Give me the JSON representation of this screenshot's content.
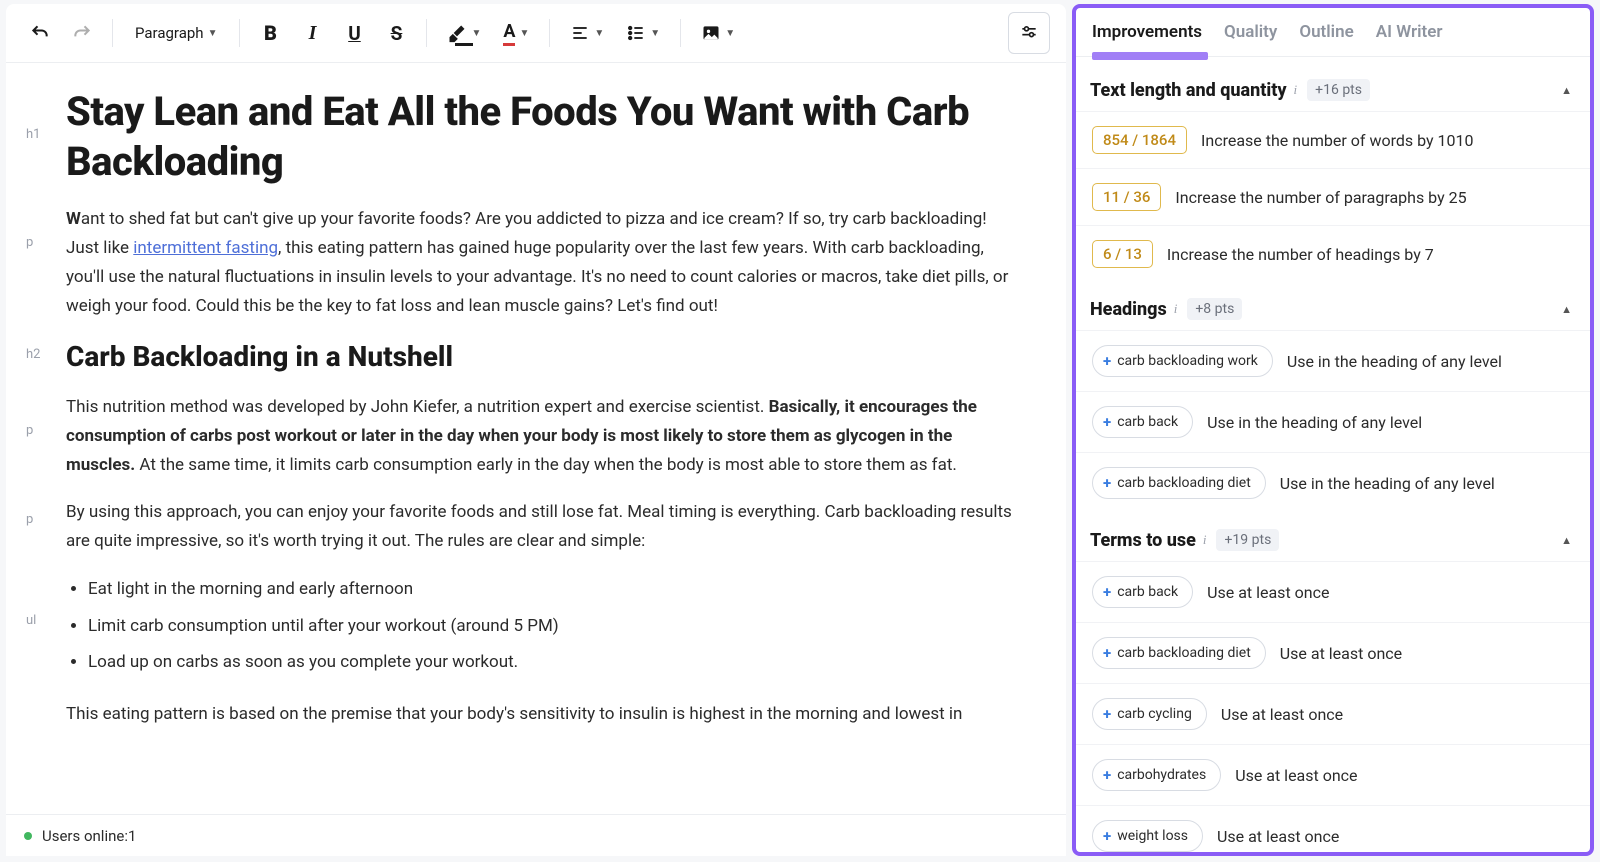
{
  "toolbar": {
    "block_format": "Paragraph"
  },
  "document": {
    "h1_tag": "h1",
    "h1": "Stay Lean and Eat All the Foods You Want with Carb Backloading",
    "p1_tag": "p",
    "p1_lead": "W",
    "p1_a": "ant to shed fat but can't give up your favorite foods? Are you addicted to pizza and ice cream? If so, try carb backloading! Just like ",
    "p1_link": "intermittent fasting",
    "p1_b": ", this eating pattern has gained huge popularity over the last few years. With carb backloading, you'll use the natural fluctuations in insulin levels to your advantage. It's no need to count calories or macros, take diet pills, or weigh your food. Could this be the key to fat loss and lean muscle gains? Let's find out!",
    "h2_tag": "h2",
    "h2": "Carb Backloading in a Nutshell",
    "p2_tag": "p",
    "p2_a": "This nutrition method was developed by John Kiefer, a nutrition expert and exercise scientist. ",
    "p2_bold": "Basically, it encourages the consumption of carbs post workout or later in the day when your body is most likely to store them as glycogen in the muscles.",
    "p2_b": " At the same time, it limits carb consumption early in the day when the body is most able to store them as fat.",
    "p3_tag": "p",
    "p3": "By using this approach, you can enjoy your favorite foods and still lose fat. Meal timing is everything. Carb backloading results are quite impressive, so it's worth trying it out. The rules are clear and simple:",
    "ul_tag": "ul",
    "li1": "Eat light in the morning and early afternoon",
    "li2": "Limit carb consumption until after your workout (around 5 PM)",
    "li3": "Load up on carbs as soon as you complete your workout.",
    "p4": "This eating pattern is based on the premise that your body's sensitivity to insulin is highest in the morning and lowest in"
  },
  "status": {
    "users_label": "Users online: ",
    "users_count": "1"
  },
  "sidebar": {
    "tabs": {
      "improvements": "Improvements",
      "quality": "Quality",
      "outline": "Outline",
      "ai": "AI Writer"
    },
    "sections": {
      "length": {
        "title": "Text length and quantity",
        "pts": "+16 pts",
        "items": [
          {
            "count": "854 / 1864",
            "desc": "Increase the number of words by 1010"
          },
          {
            "count": "11 / 36",
            "desc": "Increase the number of paragraphs by 25"
          },
          {
            "count": "6 / 13",
            "desc": "Increase the number of headings by 7"
          }
        ]
      },
      "headings": {
        "title": "Headings",
        "pts": "+8 pts",
        "items": [
          {
            "term": "carb backloading work",
            "desc": "Use in the heading of any level"
          },
          {
            "term": "carb back",
            "desc": "Use in the heading of any level"
          },
          {
            "term": "carb backloading diet",
            "desc": "Use in the heading of any level"
          }
        ]
      },
      "terms": {
        "title": "Terms to use",
        "pts": "+19 pts",
        "items": [
          {
            "term": "carb back",
            "desc": "Use at least once"
          },
          {
            "term": "carb backloading diet",
            "desc": "Use at least once"
          },
          {
            "term": "carb cycling",
            "desc": "Use at least once"
          },
          {
            "term": "carbohydrates",
            "desc": "Use at least once"
          },
          {
            "term": "weight loss",
            "desc": "Use at least once"
          }
        ]
      }
    }
  }
}
